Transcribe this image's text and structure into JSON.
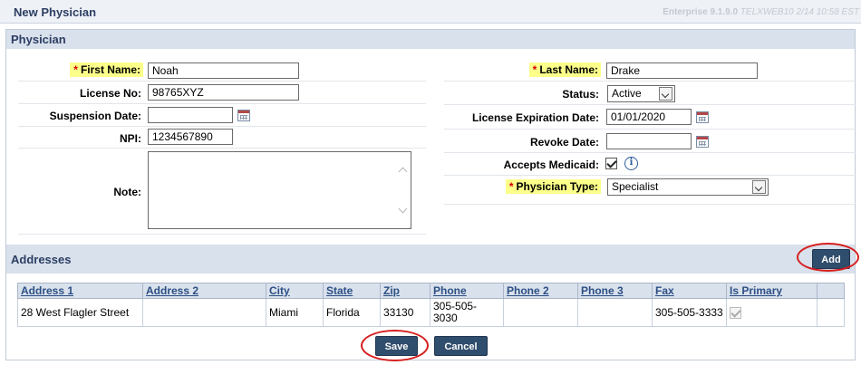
{
  "header": {
    "title": "New Physician",
    "version": "Enterprise 9.1.9.0",
    "server_info": "TELXWEB10 2/14 10:58 EST"
  },
  "physician_section": {
    "title": "Physician",
    "first_name": {
      "label": "First Name:",
      "value": "Noah",
      "required_marker": "*"
    },
    "license_no": {
      "label": "License No:",
      "value": "98765XYZ"
    },
    "suspension_date": {
      "label": "Suspension Date:",
      "value": ""
    },
    "npi": {
      "label": "NPI:",
      "value": "1234567890"
    },
    "note": {
      "label": "Note:",
      "value": ""
    },
    "last_name": {
      "label": "Last Name:",
      "value": "Drake",
      "required_marker": "*"
    },
    "status": {
      "label": "Status:",
      "value": "Active"
    },
    "license_expiration_date": {
      "label": "License Expiration Date:",
      "value": "01/01/2020"
    },
    "revoke_date": {
      "label": "Revoke Date:",
      "value": ""
    },
    "accepts_medicaid": {
      "label": "Accepts Medicaid:",
      "checked": true
    },
    "physician_type": {
      "label": "Physician Type:",
      "value": "Specialist",
      "required_marker": "*"
    }
  },
  "addresses_section": {
    "title": "Addresses",
    "add_button": "Add",
    "columns": [
      "Address 1",
      "Address 2",
      "City",
      "State",
      "Zip",
      "Phone",
      "Phone 2",
      "Phone 3",
      "Fax",
      "Is Primary"
    ],
    "rows": [
      {
        "address1": "28 West Flagler Street",
        "address2": "",
        "city": "Miami",
        "state": "Florida",
        "zip": "33130",
        "phone": "305-505-3030",
        "phone2": "",
        "phone3": "",
        "fax": "305-505-3333",
        "is_primary": true
      }
    ]
  },
  "actions": {
    "save": "Save",
    "cancel": "Cancel"
  },
  "colors": {
    "accent": "#2f4d6c",
    "section_bg": "#d9e1ec",
    "required_highlight": "#fcff8a",
    "callout_ring": "#d61f1f"
  },
  "icons": {
    "calendar": "calendar-icon",
    "info": "info-icon",
    "dropdown": "chevron-down-icon"
  }
}
